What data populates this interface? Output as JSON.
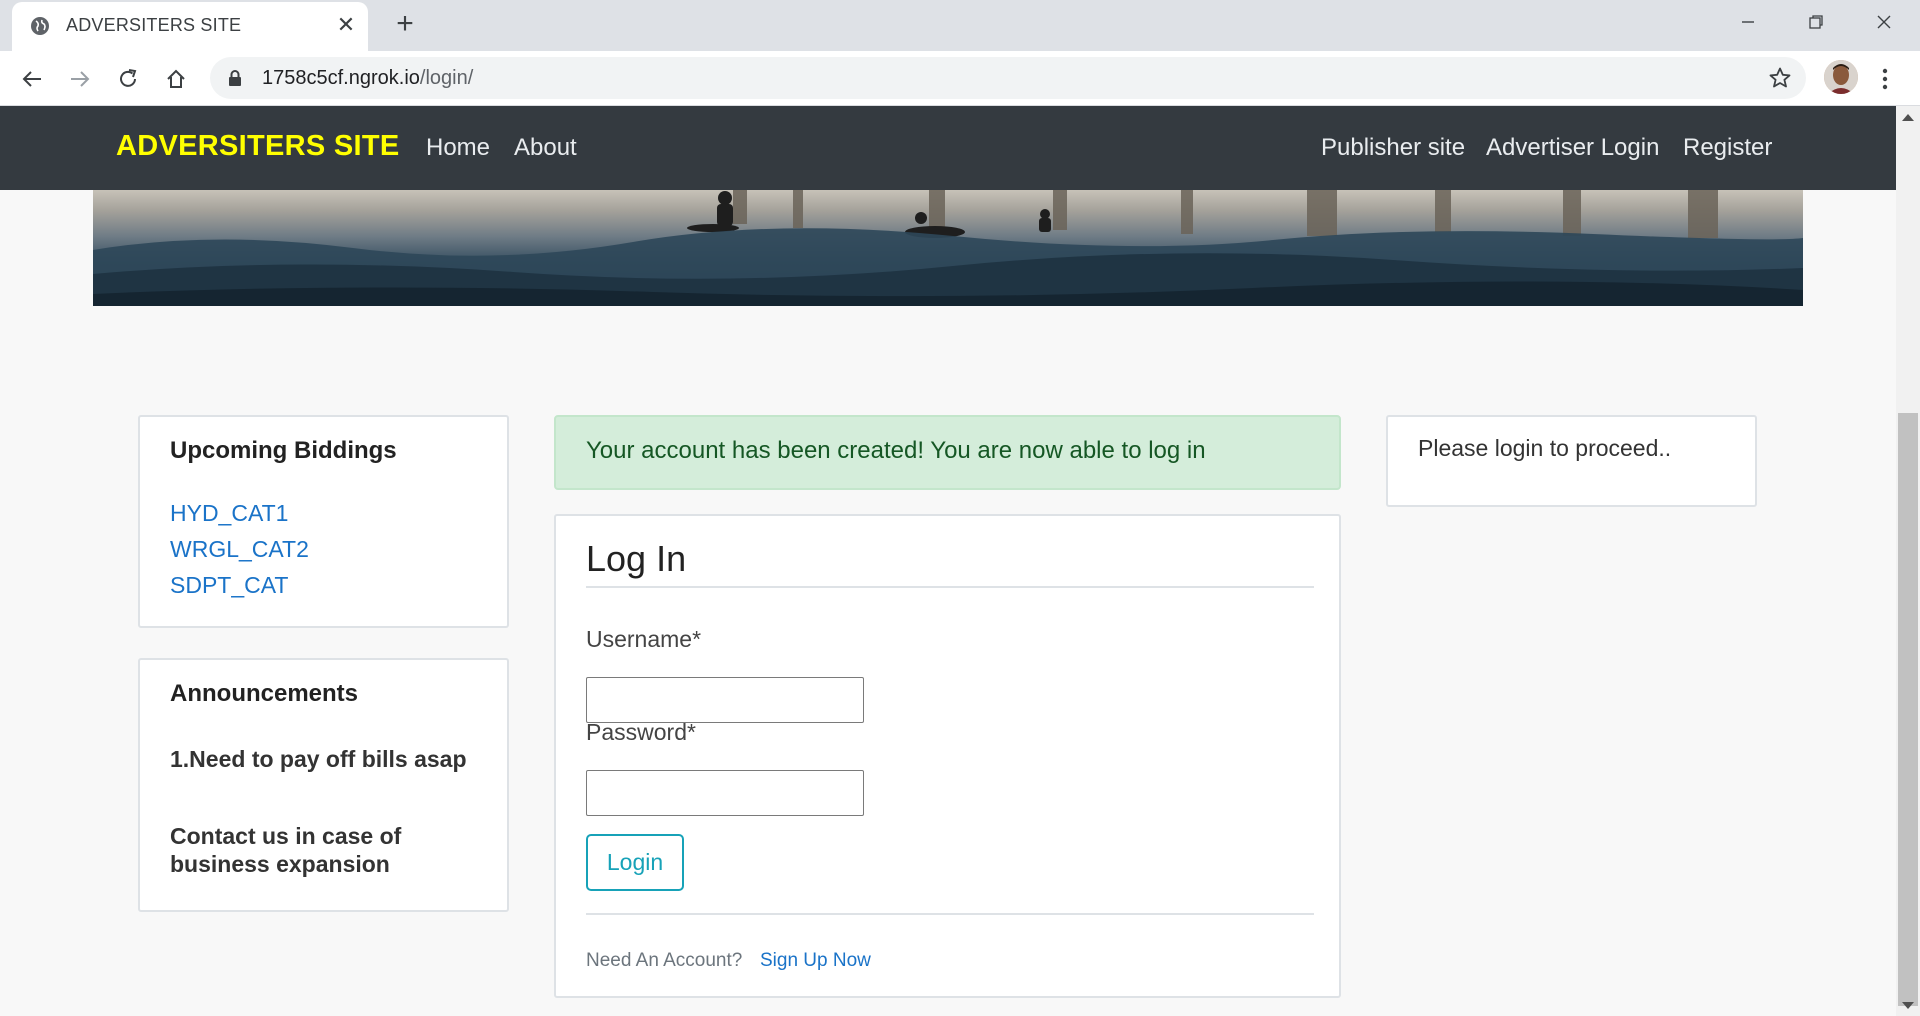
{
  "browser": {
    "tab_title": "ADVERSITERS SITE",
    "url_host": "1758c5cf.ngrok.io",
    "url_path": "/login/"
  },
  "navbar": {
    "brand": "ADVERSITERS SITE",
    "left_links": [
      "Home",
      "About"
    ],
    "right_links": [
      "Publisher site",
      "Advertiser Login",
      "Register"
    ]
  },
  "biddings": {
    "heading": "Upcoming Biddings",
    "items": [
      "HYD_CAT1",
      "WRGL_CAT2",
      "SDPT_CAT"
    ]
  },
  "announcements": {
    "heading": "Announcements",
    "items": [
      "1.Need to pay off bills asap",
      "Contact us in case of business expansion"
    ]
  },
  "alert": {
    "message": "Your account has been created! You are now able to log in"
  },
  "login": {
    "title": "Log In",
    "username_label": "Username*",
    "username_value": "",
    "password_label": "Password*",
    "password_value": "",
    "submit_label": "Login",
    "need_account": "Need An Account?",
    "signup_link": "Sign Up Now"
  },
  "sidebar_right": {
    "message": "Please login to proceed.."
  },
  "colors": {
    "brand_yellow": "#ffff00",
    "navbar_bg": "#343a40",
    "link_blue": "#1a73c8",
    "button_teal": "#17a2b8",
    "alert_bg": "#d4edda"
  }
}
